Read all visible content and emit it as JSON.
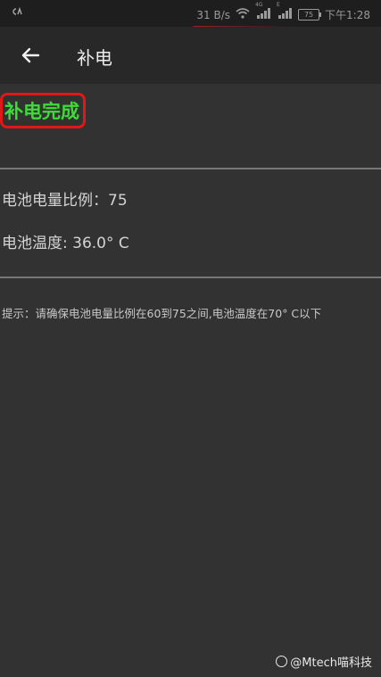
{
  "status_bar": {
    "left_icon": "ca-icon",
    "network_speed": "31 B/s",
    "signal_label_1": "4G",
    "signal_label_2": "E",
    "battery_level": "75",
    "time": "下午1:28",
    "accent_color": "#cc2020"
  },
  "app_bar": {
    "back_icon": "arrow-left-icon",
    "title": "补电"
  },
  "status": {
    "message": "补电完成",
    "message_color": "#3ddc37"
  },
  "battery_info": {
    "level_label": "电池电量比例：",
    "level_value": "75",
    "temp_label": "电池温度: ",
    "temp_value": "36.0° C"
  },
  "hint": {
    "text": "提示：请确保电池电量比例在60到75之间,电池温度在70° C以下"
  },
  "watermark": {
    "text": "@Mtech喵科技"
  }
}
